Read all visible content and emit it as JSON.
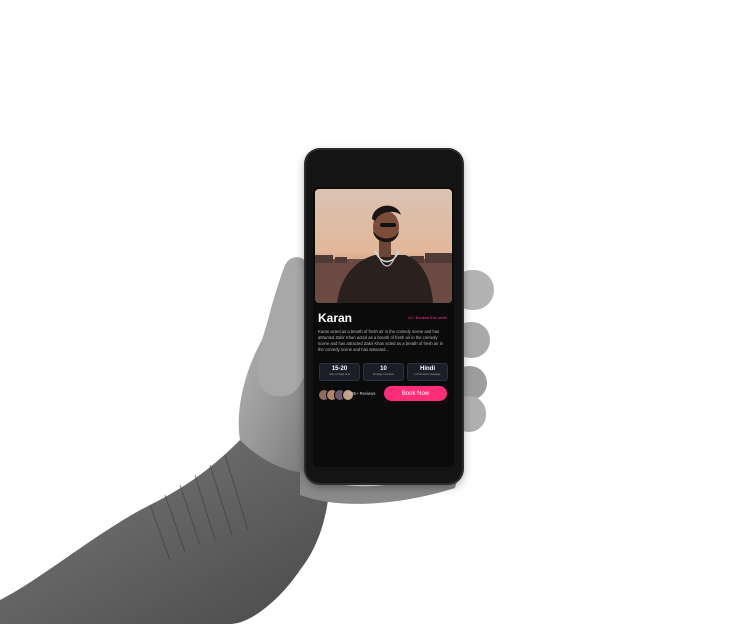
{
  "profile": {
    "name": "Karan",
    "booked_badge": "12+ Booked this week",
    "description": "Karan acted as a breath of fresh air in the comedy scene and has attracted Zakir Khan acted as a breath of fresh air in the comedy scene and has attracted Zakir Khan acted as a breath of fresh air in the comedy scene and has attracted..."
  },
  "stats": [
    {
      "value": "15-20",
      "label": "mins of stage time"
    },
    {
      "value": "10",
      "label": "all stage members"
    },
    {
      "value": "Hindi",
      "label": "performance language"
    }
  ],
  "footer": {
    "reviews": "235+ Reviews",
    "book_button": "Book Now"
  },
  "colors": {
    "accent": "#ff2d78",
    "background": "#0b0b0c",
    "stat_card": "#1b1e27"
  }
}
